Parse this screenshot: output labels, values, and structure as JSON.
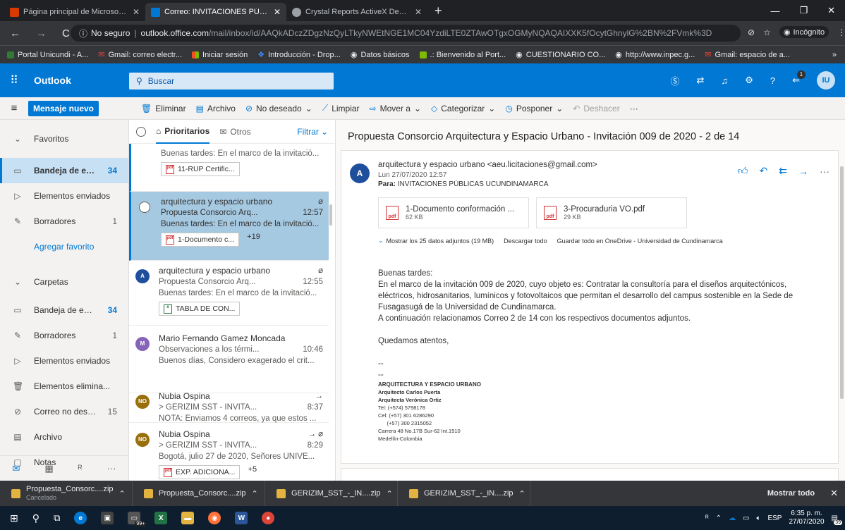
{
  "browser": {
    "tabs": [
      {
        "title": "Página principal de Microsoft Off",
        "color": "#d83b01",
        "active": false
      },
      {
        "title": "Correo: INVITACIONES PÚBLICAS",
        "color": "#0078d4",
        "active": true
      },
      {
        "title": "Crystal Reports ActiveX Designer",
        "color": "#9aa0a6",
        "active": false
      }
    ],
    "new_tab": "+",
    "security": "No seguro",
    "url_host": "outlook.office.com",
    "url_path": "/mail/inbox/id/AAQkADczZDgzNzQyLTkyNWEtNGE1MC04YzdiLTE0ZTAwOTgxOGMyNQAQAIXXK5fOcytGhnylG%2BN%2FVmk%3D",
    "incognito": "Incógnito",
    "bookmarks": [
      "Portal Unicundi - A...",
      "Gmail: correo electr...",
      "Iniciar sesión",
      "Introducción - Drop...",
      "Datos básicos",
      ".: Bienvenido al Port...",
      "CUESTIONARIO CO...",
      "http://www.inpec.g...",
      "Gmail: espacio de a..."
    ],
    "bookmarks_more": "»"
  },
  "outlook": {
    "app_name": "Outlook",
    "search_placeholder": "Buscar",
    "new_message": "Mensaje nuevo",
    "notif_count": "1",
    "user_initials": "IU",
    "commands": [
      "Eliminar",
      "Archivo",
      "No deseado",
      "Limpiar",
      "Mover a",
      "Categorizar",
      "Posponer",
      "Deshacer"
    ],
    "more": "···"
  },
  "nav": {
    "favorites": "Favoritos",
    "fav_items": [
      {
        "label": "Bandeja de en...",
        "count": "34",
        "selected": true,
        "icon": "inbox-icon"
      },
      {
        "label": "Elementos enviados",
        "count": "",
        "selected": false,
        "icon": "send-icon"
      },
      {
        "label": "Borradores",
        "count": "1",
        "selected": false,
        "icon": "pencil-icon"
      }
    ],
    "add_fav": "Agregar favorito",
    "folders": "Carpetas",
    "folder_items": [
      {
        "label": "Bandeja de ent...",
        "count": "34",
        "icon": "inbox-icon"
      },
      {
        "label": "Borradores",
        "count": "1",
        "icon": "pencil-icon"
      },
      {
        "label": "Elementos enviados",
        "count": "",
        "icon": "send-icon"
      },
      {
        "label": "Elementos elimina...",
        "count": "",
        "icon": "trash-icon"
      },
      {
        "label": "Correo no dese...",
        "count": "15",
        "icon": "block-icon"
      },
      {
        "label": "Archivo",
        "count": "",
        "icon": "archive-icon"
      },
      {
        "label": "Notas",
        "count": "",
        "icon": "note-icon"
      }
    ]
  },
  "list": {
    "tab_focused": "Prioritarios",
    "tab_other": "Otros",
    "filter": "Filtrar",
    "messages": [
      {
        "sender": "",
        "subject": "",
        "time": "",
        "preview": "Buenas tardes: En el marco de la invitació...",
        "attach": "11-RUP Certific...",
        "extra": "",
        "initials": "",
        "avatar_color": ""
      },
      {
        "sender": "arquitectura y espacio urbano",
        "subject": "Propuesta Consorcio Arq...",
        "time": "12:57",
        "preview": "Buenas tardes: En el marco de la invitació...",
        "attach": "1-Documento c...",
        "extra": "+19",
        "initials": "",
        "avatar_color": ""
      },
      {
        "sender": "arquitectura y espacio urbano",
        "subject": "Propuesta Consorcio Arq...",
        "time": "12:55",
        "preview": "Buenas tardes: En el marco de la invitació...",
        "attach": "TABLA DE CON...",
        "extra": "",
        "initials": "A",
        "avatar_color": "#1f4e9c"
      },
      {
        "sender": "Mario Fernando Gamez Moncada",
        "subject": "Observaciones a los térmi...",
        "time": "10:46",
        "preview": "Buenos días, Considero exagerado el crit...",
        "attach": "",
        "extra": "",
        "initials": "M",
        "avatar_color": "#8764b8"
      },
      {
        "sender": "Nubia Ospina",
        "subject": "> GERIZIM SST - INVITA...",
        "time": "8:37",
        "preview": "NOTA: Enviamos 4 correos, ya que estos ...",
        "attach": "",
        "extra": "",
        "initials": "NO",
        "avatar_color": "#986f0b"
      },
      {
        "sender": "Nubia Ospina",
        "subject": "> GERIZIM SST - INVITA...",
        "time": "8:29",
        "preview": "Bogotá, julio 27 de 2020, Señores UNIVE...",
        "attach": "EXP. ADICIONA...",
        "extra": "+5",
        "initials": "NO",
        "avatar_color": "#986f0b"
      }
    ]
  },
  "reading": {
    "subject": "Propuesta Consorcio Arquitectura y Espacio Urbano - Invitación 009 de 2020 - 2 de 14",
    "from": "arquitectura y espacio urbano <aeu.licitaciones@gmail.com>",
    "date": "Lun 27/07/2020 12:57",
    "to_label": "Para:",
    "to": "INVITACIONES PÚBLICAS UCUNDINAMARCA",
    "avatar": "A",
    "attachments": [
      {
        "name": "1-Documento conformación ...",
        "size": "62 KB"
      },
      {
        "name": "3-Procuraduria VO.pdf",
        "size": "29 KB"
      }
    ],
    "show_all": "Mostrar los 25 datos adjuntos (19 MB)",
    "download_all": "Descargar todo",
    "save_onedrive": "Guardar todo en OneDrive - Universidad de Cundinamarca",
    "greeting": "Buenas tardes:",
    "para1": "En el marco de la invitación 009 de 2020, cuyo objeto es:  Contratar la consultoría para el diseños arquitectónicos, eléctricos, hidrosanitarios, lumínicos y fotovoltaicos que permitan el desarrollo del campus sostenible en la Sede de Fusagasugá de la Universidad de Cundinamarca.",
    "para2": "A continuación relacionamos Correo 2 de 14 con los respectivos documentos adjuntos.",
    "closing": "Quedamos atentos,",
    "dash": "--",
    "sig_company": "ARQUITECTURA Y ESPACIO URBANO",
    "sig_lines": [
      "Arquitecto Carlos Puerta",
      "Arquitecta Verónica Ortiz"
    ],
    "sig_contact": [
      "Tel: (+574) 5798178",
      "Cel: (+57) 301 6286290",
      "      (+57) 300 2315052",
      "Carrera 48 No.17B Sur-62 Int.1510",
      "Medellín-Colombia"
    ]
  },
  "downloads": {
    "items": [
      {
        "name": "Propuesta_Consorc....zip",
        "status": "Cancelado"
      },
      {
        "name": "Propuesta_Consorc....zip",
        "status": ""
      },
      {
        "name": "GERIZIM_SST_-_IN....zip",
        "status": ""
      },
      {
        "name": "GERIZIM_SST_-_IN....zip",
        "status": ""
      }
    ],
    "show_all": "Mostrar todo"
  },
  "taskbar": {
    "lang": "ESP",
    "time": "6:35 p. m.",
    "date": "27/07/2020",
    "notif": "39",
    "badge": "99+"
  }
}
